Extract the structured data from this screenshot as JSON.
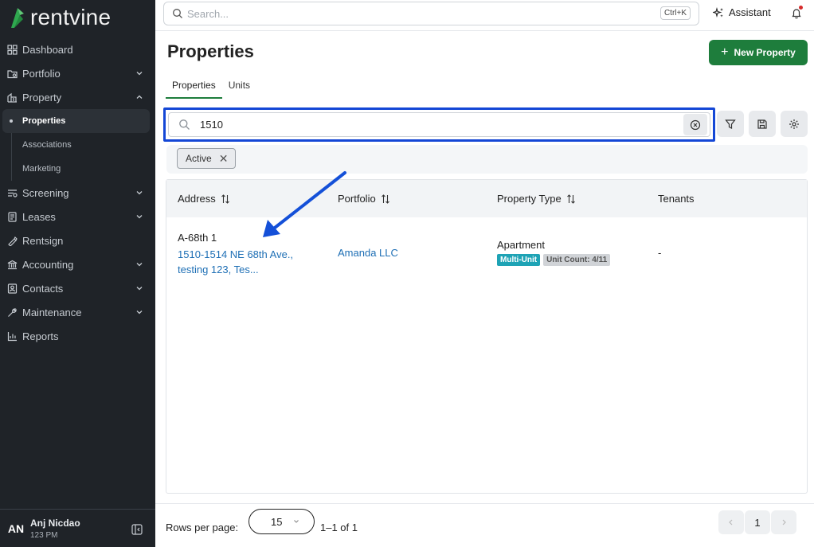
{
  "app": {
    "brand": "rentvine",
    "accent_color": "#1e7d3c",
    "sidebar_bg": "#1f2328"
  },
  "sidebar": {
    "items": [
      {
        "label": "Dashboard",
        "icon": "dashboard-icon"
      },
      {
        "label": "Portfolio",
        "icon": "portfolio-icon",
        "expandable": true
      },
      {
        "label": "Property",
        "icon": "property-icon",
        "expanded": true
      },
      {
        "label": "Screening",
        "icon": "screening-icon",
        "expandable": true
      },
      {
        "label": "Leases",
        "icon": "leases-icon",
        "expandable": true
      },
      {
        "label": "Rentsign",
        "icon": "rentsign-icon"
      },
      {
        "label": "Accounting",
        "icon": "accounting-icon",
        "expandable": true
      },
      {
        "label": "Contacts",
        "icon": "contacts-icon",
        "expandable": true
      },
      {
        "label": "Maintenance",
        "icon": "maintenance-icon",
        "expandable": true
      },
      {
        "label": "Reports",
        "icon": "reports-icon"
      }
    ],
    "property_sub": [
      "Properties",
      "Associations",
      "Marketing"
    ],
    "active_sub": "Properties"
  },
  "user": {
    "initials": "AN",
    "name": "Anj Nicdao",
    "sub": "123 PM"
  },
  "topbar": {
    "search_placeholder": "Search...",
    "shortcut": "Ctrl+K",
    "assistant_label": "Assistant"
  },
  "page": {
    "title": "Properties",
    "new_button": "New Property",
    "tabs": [
      "Properties",
      "Units"
    ],
    "active_tab": "Properties"
  },
  "search": {
    "value": "1510"
  },
  "filters": {
    "chips": [
      "Active"
    ]
  },
  "table": {
    "columns": [
      "Address",
      "Portfolio",
      "Property Type",
      "Tenants"
    ],
    "rows": [
      {
        "address_code": "A-68th 1",
        "address_line1": "1510-1514 NE 68th Ave.,",
        "address_line2": "testing 123, Tes...",
        "portfolio": "Amanda LLC",
        "property_type": "Apartment",
        "badge_type": "Multi-Unit",
        "badge_count": "Unit Count: 4/11",
        "tenants": "-"
      }
    ]
  },
  "pagination": {
    "rows_per_page_label": "Rows per page:",
    "rows_per_page": "15",
    "range": "1–1 of 1",
    "current_page": "1"
  }
}
